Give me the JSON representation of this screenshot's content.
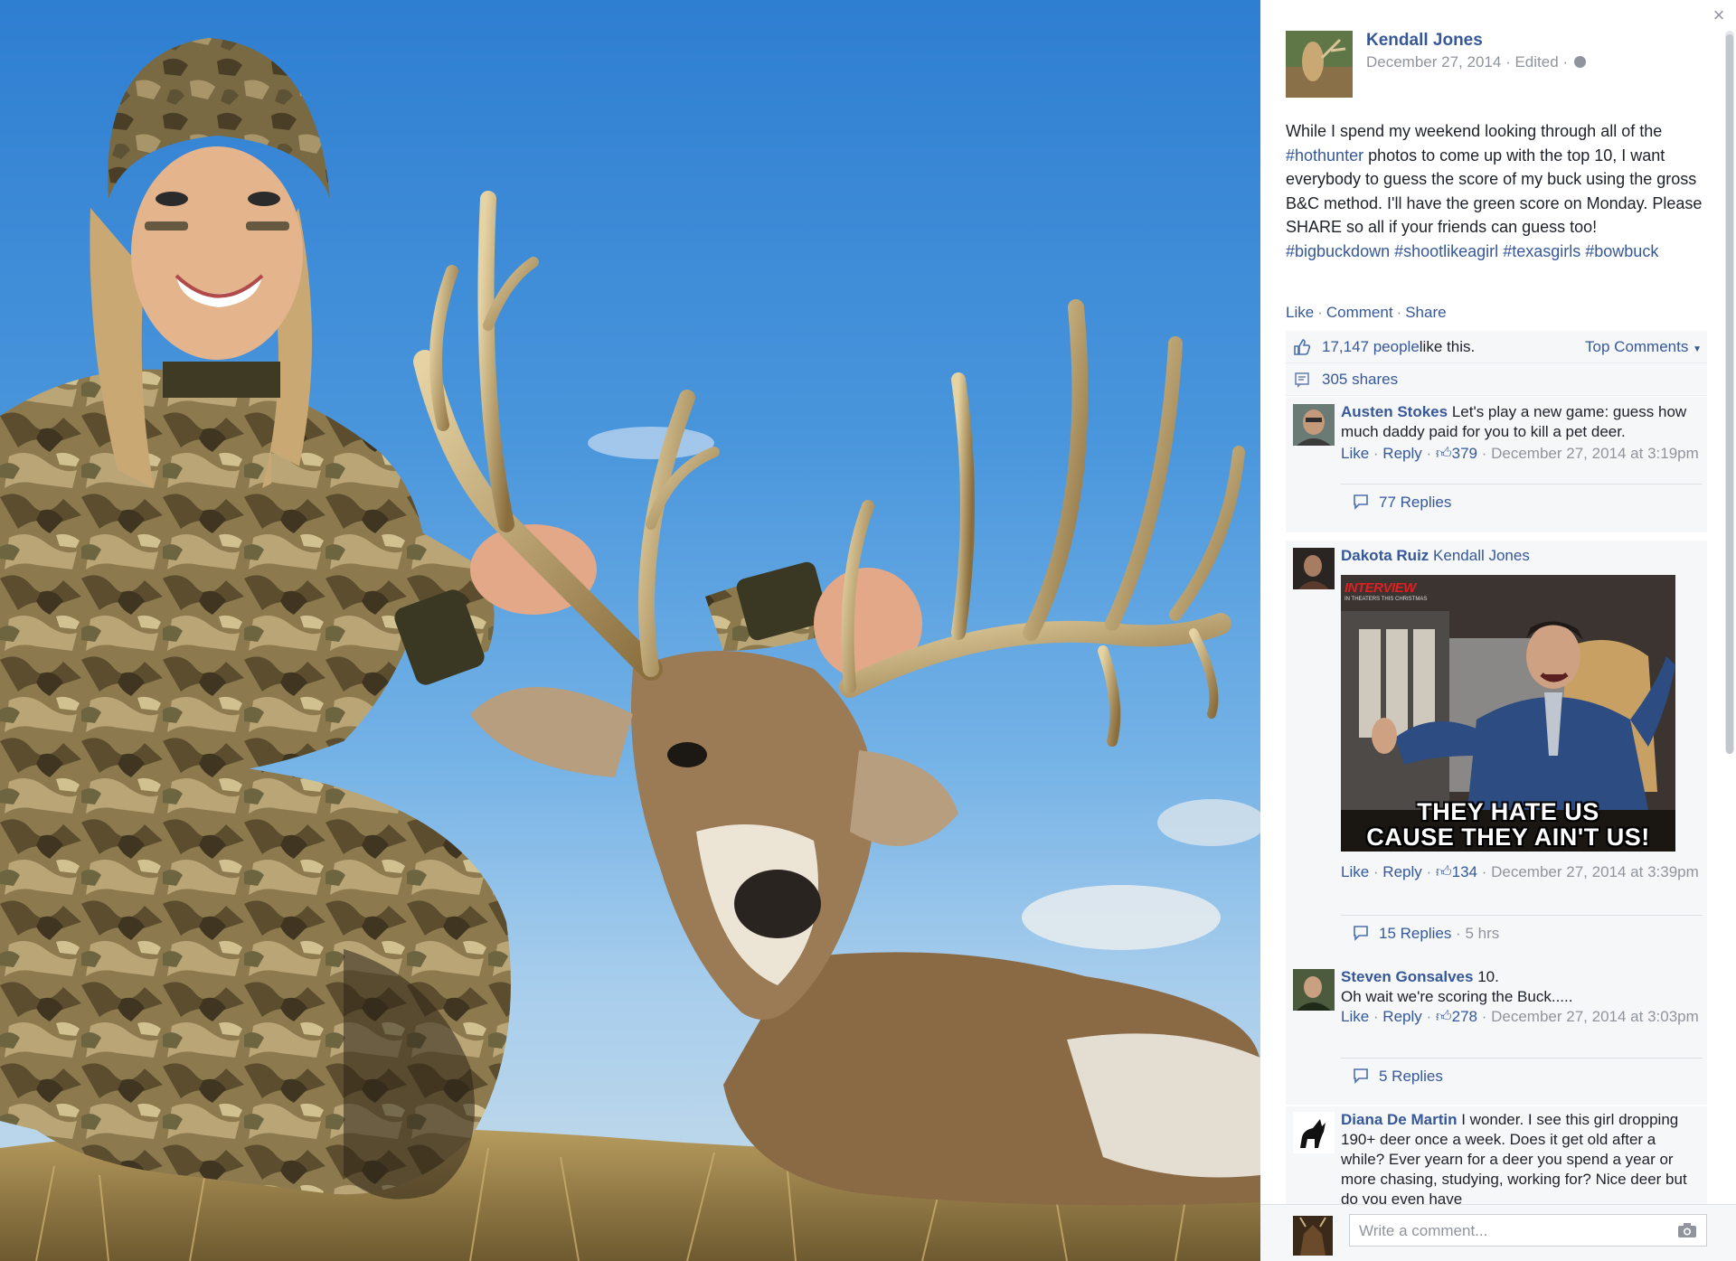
{
  "window": {
    "close_glyph": "×"
  },
  "post": {
    "author": "Kendall Jones",
    "date": "December 27, 2014",
    "edited": "Edited",
    "text_parts": [
      {
        "t": "While I spend my weekend looking through all of the ",
        "tag": false
      },
      {
        "t": "#hothunter",
        "tag": true
      },
      {
        "t": " photos to come up with the top 10, I want everybody to guess the score of my buck using the gross B&C method. I'll have the green score on Monday. Please SHARE so all if your friends can guess too! ",
        "tag": false
      },
      {
        "t": "#bigbuckdown",
        "tag": true
      },
      {
        "t": " ",
        "tag": false
      },
      {
        "t": "#shootlikeagirl",
        "tag": true
      },
      {
        "t": " ",
        "tag": false
      },
      {
        "t": "#texasgirls",
        "tag": true
      },
      {
        "t": " ",
        "tag": false
      },
      {
        "t": "#bowbuck",
        "tag": true
      }
    ],
    "actions": {
      "like": "Like",
      "comment": "Comment",
      "share": "Share"
    },
    "likes_count": "17,147 people",
    "likes_suffix": " like this.",
    "shares": "305 shares",
    "sort_label": "Top Comments"
  },
  "comments": [
    {
      "name": "Austen Stokes",
      "text": "Let's play a new game: guess how much daddy paid for you to kill a pet deer.",
      "like": "Like",
      "reply": "Reply",
      "likes": "379",
      "time": "December 27, 2014 at 3:19pm",
      "replies": "77 Replies"
    },
    {
      "name": "Dakota Ruiz",
      "tag": "Kendall Jones",
      "meme_brand": "INTERVIEW",
      "meme_sub": "IN THEATERS THIS CHRISTMAS",
      "meme_line1": "THEY HATE US",
      "meme_line2": "CAUSE THEY AIN'T US!",
      "like": "Like",
      "reply": "Reply",
      "likes": "134",
      "time": "December 27, 2014 at 3:39pm",
      "replies": "15 Replies",
      "replies_time": "5 hrs"
    },
    {
      "name": "Steven Gonsalves",
      "text": "10.",
      "text2": "Oh wait we're scoring the Buck.....",
      "like": "Like",
      "reply": "Reply",
      "likes": "278",
      "time": "December 27, 2014 at 3:03pm",
      "replies": "5 Replies"
    },
    {
      "name": "Diana De Martin",
      "text": "I wonder. I see this girl dropping 190+ deer once a week. Does it get old after a while? Ever yearn for a deer you spend a year or more chasing, studying, working for? Nice deer but do you even have"
    }
  ],
  "compose": {
    "placeholder": "Write a comment..."
  }
}
